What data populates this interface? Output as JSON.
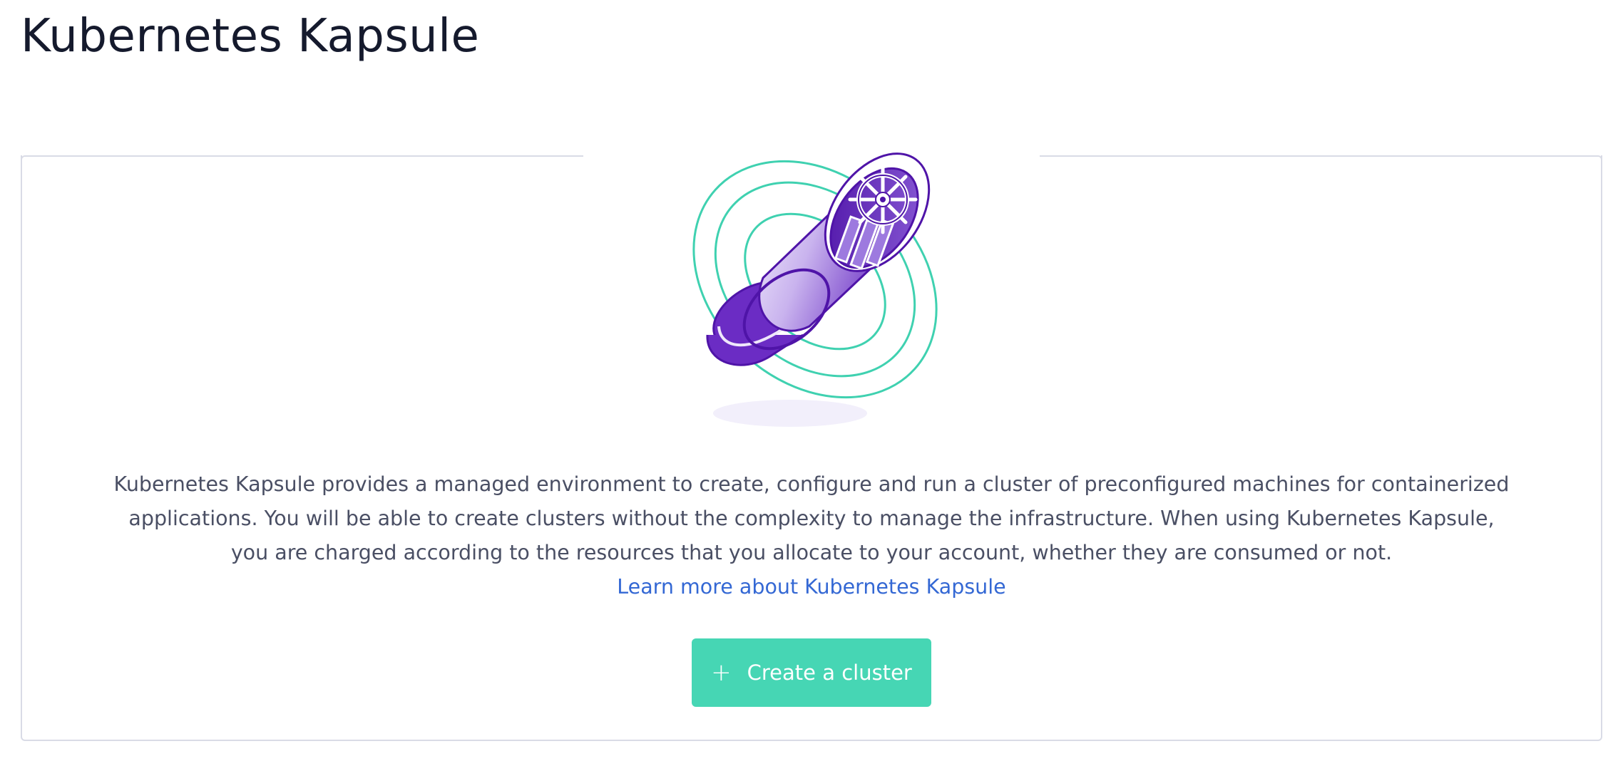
{
  "page": {
    "title": "Kubernetes Kapsule"
  },
  "empty_state": {
    "illustration": "kubernetes-capsule-illustration",
    "description": "Kubernetes Kapsule provides a managed environment to create, configure and run a cluster of preconfigured machines for containerized applications. You will be able to create clusters without the complexity to manage the infrastructure. When using Kubernetes Kapsule, you are charged according to the resources that you allocate to your account, whether they are consumed or not.",
    "learn_more_label": "Learn more about Kubernetes Kapsule",
    "create_button": {
      "icon": "plus-icon",
      "icon_glyph": "+",
      "label": "Create a cluster"
    }
  },
  "colors": {
    "title": "#151a2d",
    "body_text": "#4a4f64",
    "link": "#3468d4",
    "primary_button": "#46d6b4",
    "card_border": "#d9dbe6",
    "illustration_purple": "#4f14a8",
    "illustration_teal": "#3fd1b0"
  }
}
